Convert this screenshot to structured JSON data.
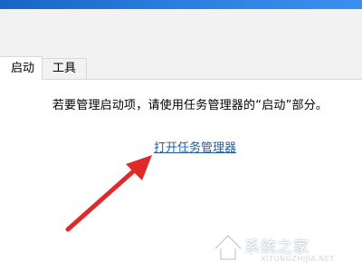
{
  "tabs": [
    {
      "label": "启动",
      "active": true
    },
    {
      "label": "工具",
      "active": false
    }
  ],
  "content": {
    "message": "若要管理启动项，请使用任务管理器的“启动”部分。",
    "link_label": "打开任务管理器"
  },
  "annotation": {
    "arrow_color": "#e02a2a"
  },
  "watermark": {
    "logo_text": "系统之家",
    "logo_url_text": "XITONGZHIJIA.NET"
  },
  "colors": {
    "title_strip": "#1f6fd6",
    "link": "#1d5ea8"
  }
}
